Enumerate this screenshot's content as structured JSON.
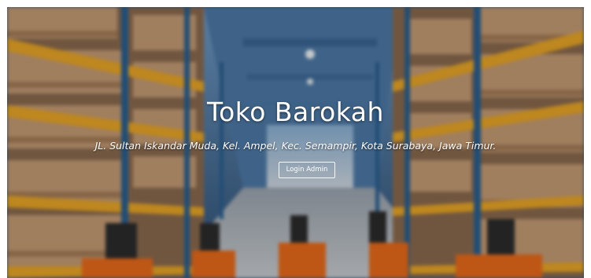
{
  "hero": {
    "title": "Toko Barokah",
    "address": "JL. Sultan Iskandar Muda, Kel. Ampel, Kec. Semampir, Kota Surabaya, Jawa Timur.",
    "login_label": "Login Admin",
    "background_icon": "warehouse-photo",
    "colors": {
      "shelf_orange": "#e8a526",
      "upright_blue": "#2a5f8f",
      "ceiling_blue": "#5f8fbf",
      "pallet_wood": "#c9a27a",
      "forklift_orange": "#e86a1a",
      "text": "#ffffff"
    }
  }
}
